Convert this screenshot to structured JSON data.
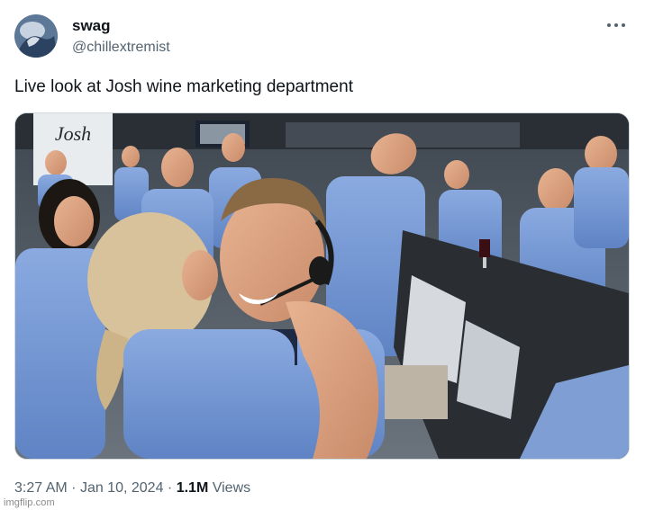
{
  "tweet": {
    "author_name": "swag",
    "author_handle": "@chillextremist",
    "text": "Live look at Josh wine marketing department",
    "time": "3:27 AM",
    "date": "Jan 10, 2024",
    "views_count": "1.1M",
    "views_label": "Views",
    "separator": "·"
  },
  "media": {
    "sign_text": "Josh"
  },
  "watermark": "imgflip.com",
  "icons": {
    "more": "more-horizontal-icon",
    "avatar": "avatar-image"
  },
  "colors": {
    "text_primary": "#0f1419",
    "text_secondary": "#536471",
    "border": "#cfd9de",
    "shirt_blue": "#7c9fd6"
  }
}
